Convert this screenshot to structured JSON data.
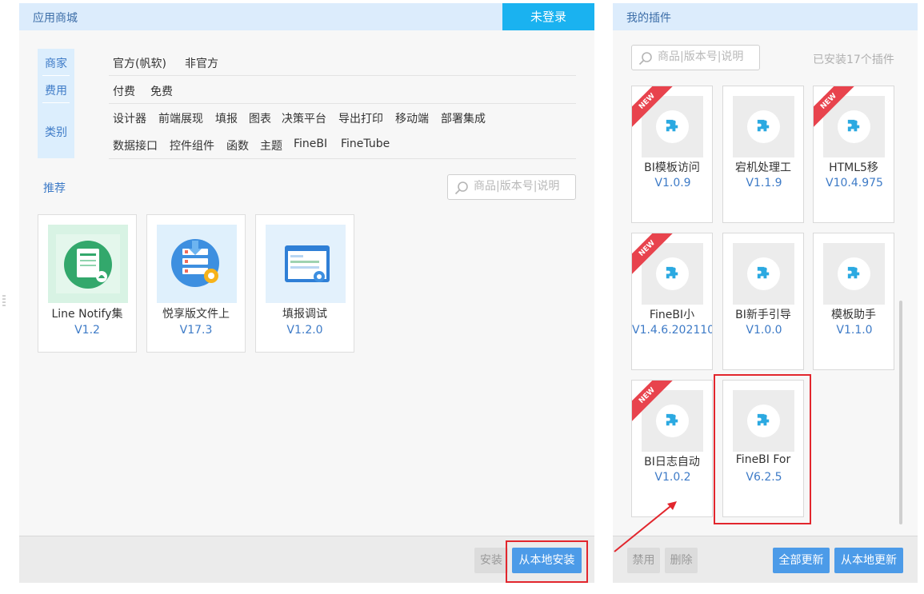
{
  "left": {
    "title": "应用商城",
    "login_button": "未登录",
    "filter_labels": [
      "商家",
      "费用",
      "类别"
    ],
    "merchant_options": [
      "官方(帆软)",
      "非官方"
    ],
    "fee_options": [
      "付费",
      "免费"
    ],
    "category_options_row1": [
      "设计器",
      "前端展现",
      "填报",
      "图表",
      "决策平台",
      "导出打印",
      "移动端",
      "部署集成"
    ],
    "category_options_row2": [
      "数据接口",
      "控件组件",
      "函数",
      "主题",
      "FineBI",
      "FineTube"
    ],
    "recommend_label": "推荐",
    "search_placeholder": "商品|版本号|说明",
    "recommended": [
      {
        "name": "Line Notify集",
        "version": "V1.2"
      },
      {
        "name": "悦享版文件上",
        "version": "V17.3"
      },
      {
        "name": "填报调试",
        "version": "V1.2.0"
      }
    ],
    "footer": {
      "install": "安装",
      "local_install": "从本地安装"
    }
  },
  "right": {
    "title": "我的插件",
    "search_placeholder": "商品|版本号|说明",
    "installed_count": "已安装17个插件",
    "new_badge": "NEW",
    "plugins": [
      {
        "name": "BI模板访问",
        "version": "V1.0.9",
        "is_new": true
      },
      {
        "name": "宕机处理工",
        "version": "V1.1.9",
        "is_new": false
      },
      {
        "name": "HTML5移",
        "version": "V10.4.975",
        "is_new": true
      },
      {
        "name": "FineBI小",
        "version": "V1.4.6.202110",
        "is_new": true
      },
      {
        "name": "BI新手引导",
        "version": "V1.0.0",
        "is_new": false
      },
      {
        "name": "模板助手",
        "version": "V1.1.0",
        "is_new": false
      },
      {
        "name": "BI日志自动",
        "version": "V1.0.2",
        "is_new": true
      },
      {
        "name": "FineBI For",
        "version": "V6.2.5",
        "is_new": false
      }
    ],
    "footer": {
      "disable": "禁用",
      "delete": "删除",
      "update_all": "全部更新",
      "local_update": "从本地更新"
    }
  },
  "colors": {
    "header_bg": "#dcecfc",
    "login_bg": "#1ab2f0",
    "primary_button": "#4c9be8",
    "link_blue": "#3e7bc7",
    "new_ribbon": "#e8434d",
    "highlight_red": "#e2262d"
  },
  "icons": [
    "search-icon",
    "puzzle-icon",
    "line-notify-thumbnail",
    "file-upload-thumbnail",
    "fill-debug-thumbnail",
    "annotation-arrow"
  ]
}
